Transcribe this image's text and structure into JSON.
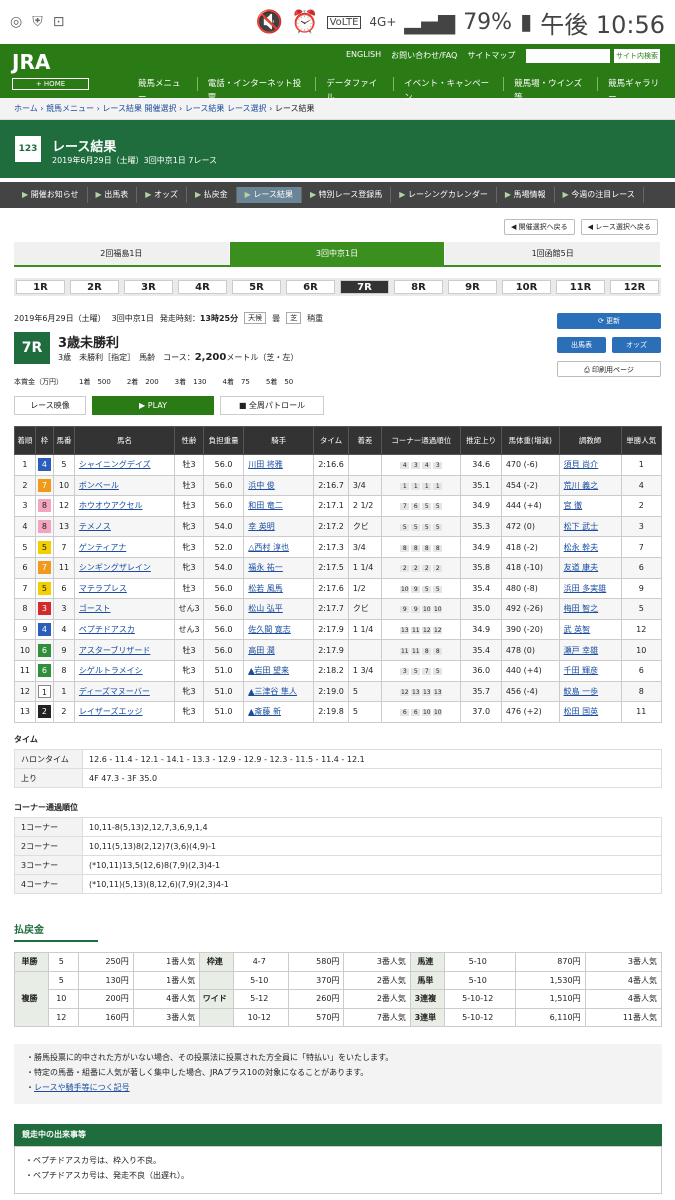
{
  "status": {
    "battery": "79%",
    "time": "午後 10:56",
    "net": "4G+",
    "volte": "VoLTE"
  },
  "header": {
    "logo": "JRA",
    "home": "+ HOME",
    "top_links": [
      "ENGLISH",
      "お問い合わせ/FAQ",
      "サイトマップ"
    ],
    "search_btn": "サイト内検索",
    "menu": [
      "競馬メニュー",
      "電話・インターネット投票",
      "データファイル",
      "イベント・キャンペーン",
      "競馬場・ウインズ等",
      "競馬ギャラリー"
    ]
  },
  "breadcrumb": [
    "ホーム",
    "競馬メニュー",
    "レース結果 開催選択",
    "レース結果 レース選択",
    "レース結果"
  ],
  "title": {
    "heading": "レース結果",
    "sub": "2019年6月29日（土曜）3回中京1日 7レース"
  },
  "nav": [
    "開催お知らせ",
    "出馬表",
    "オッズ",
    "払戻金",
    "レース結果",
    "特別レース登録馬",
    "レーシングカレンダー",
    "馬場情報",
    "今週の注目レース"
  ],
  "back_buttons": [
    "開催選択へ戻る",
    "レース選択へ戻る"
  ],
  "venues": [
    "2回福島1日",
    "3回中京1日",
    "1回函館5日"
  ],
  "races": [
    "1R",
    "2R",
    "3R",
    "4R",
    "5R",
    "6R",
    "7R",
    "8R",
    "9R",
    "10R",
    "11R",
    "12R"
  ],
  "race": {
    "date": "2019年6月29日（土曜）",
    "meet": "3回中京1日",
    "post_label": "発走時刻：",
    "post": "13時25分",
    "weather": "天候",
    "weather_val": "曇",
    "track": "芝",
    "cond": "稍重",
    "num": "7R",
    "name": "3歳未勝利",
    "meta": "3歳　未勝利［指定］　馬齢",
    "course": "コース：",
    "dist": "2,200",
    "unit": "メートル（芝・左）"
  },
  "prize": {
    "label": "本賞金（万円）",
    "items": [
      "1着　500",
      "2着　200",
      "3着　130",
      "4着　75",
      "5着　50"
    ]
  },
  "side_buttons": [
    "更新",
    "出馬表",
    "オッズ",
    "印刷用ページ"
  ],
  "video": [
    "レース映像",
    "PLAY",
    "全周パトロール"
  ],
  "columns": [
    "着順",
    "枠",
    "馬番",
    "馬名",
    "性齢",
    "負担重量",
    "騎手",
    "タイム",
    "着差",
    "コーナー通過順位",
    "推定上り",
    "馬体重(増減)",
    "調教師",
    "単勝人気"
  ],
  "results": [
    {
      "rank": "1",
      "waku": "4",
      "num": "5",
      "name": "シャイニングデイズ",
      "sex": "牡3",
      "wt": "56.0",
      "jockey": "川田 将雅",
      "time": "2:16.6",
      "margin": "",
      "pass": [
        "4",
        "3",
        "4",
        "3"
      ],
      "agari": "34.6",
      "body": "470 (-6)",
      "trainer": "須貝 尚介",
      "pop": "1"
    },
    {
      "rank": "2",
      "waku": "7",
      "num": "10",
      "name": "ボンベール",
      "sex": "牡3",
      "wt": "56.0",
      "jockey": "浜中 俊",
      "time": "2:16.7",
      "margin": "3/4",
      "pass": [
        "1",
        "1",
        "1",
        "1"
      ],
      "agari": "35.1",
      "body": "454 (-2)",
      "trainer": "荒川 義之",
      "pop": "4"
    },
    {
      "rank": "3",
      "waku": "8",
      "num": "12",
      "name": "ホウオウアクセル",
      "sex": "牡3",
      "wt": "56.0",
      "jockey": "和田 竜二",
      "time": "2:17.1",
      "margin": "2 1/2",
      "pass": [
        "7",
        "6",
        "5",
        "5"
      ],
      "agari": "34.9",
      "body": "444 (+4)",
      "trainer": "宮 徹",
      "pop": "2"
    },
    {
      "rank": "4",
      "waku": "8",
      "num": "13",
      "name": "テメノス",
      "sex": "牝3",
      "wt": "54.0",
      "jockey": "幸 英明",
      "time": "2:17.2",
      "margin": "クビ",
      "pass": [
        "5",
        "5",
        "5",
        "5"
      ],
      "agari": "35.3",
      "body": "472 (0)",
      "trainer": "松下 武士",
      "pop": "3"
    },
    {
      "rank": "5",
      "waku": "5",
      "num": "7",
      "name": "ゲンティアナ",
      "sex": "牝3",
      "wt": "52.0",
      "jockey": "△西村 淳也",
      "time": "2:17.3",
      "margin": "3/4",
      "pass": [
        "8",
        "8",
        "8",
        "8"
      ],
      "agari": "34.9",
      "body": "418 (-2)",
      "trainer": "松永 幹夫",
      "pop": "7"
    },
    {
      "rank": "6",
      "waku": "7",
      "num": "11",
      "name": "シンギングザレイン",
      "sex": "牝3",
      "wt": "54.0",
      "jockey": "福永 祐一",
      "time": "2:17.5",
      "margin": "1 1/4",
      "pass": [
        "2",
        "2",
        "2",
        "2"
      ],
      "agari": "35.8",
      "body": "418 (-10)",
      "trainer": "友道 康夫",
      "pop": "6"
    },
    {
      "rank": "7",
      "waku": "5",
      "num": "6",
      "name": "マテラプレス",
      "sex": "牡3",
      "wt": "56.0",
      "jockey": "松若 風馬",
      "time": "2:17.6",
      "margin": "1/2",
      "pass": [
        "10",
        "9",
        "5",
        "5"
      ],
      "agari": "35.4",
      "body": "480 (-8)",
      "trainer": "浜田 多実雄",
      "pop": "9"
    },
    {
      "rank": "8",
      "waku": "3",
      "num": "3",
      "name": "ゴースト",
      "sex": "せん3",
      "wt": "56.0",
      "jockey": "松山 弘平",
      "time": "2:17.7",
      "margin": "クビ",
      "pass": [
        "9",
        "9",
        "10",
        "10"
      ],
      "agari": "35.0",
      "body": "492 (-26)",
      "trainer": "梅田 智之",
      "pop": "5"
    },
    {
      "rank": "9",
      "waku": "4",
      "num": "4",
      "name": "ペプチドアスカ",
      "sex": "せん3",
      "wt": "56.0",
      "jockey": "佐久間 寛志",
      "time": "2:17.9",
      "margin": "1 1/4",
      "pass": [
        "13",
        "11",
        "12",
        "12"
      ],
      "agari": "34.9",
      "body": "390 (-20)",
      "trainer": "武 英智",
      "pop": "12"
    },
    {
      "rank": "10",
      "waku": "6",
      "num": "9",
      "name": "アスターブリザード",
      "sex": "牡3",
      "wt": "56.0",
      "jockey": "高田 潤",
      "time": "2:17.9",
      "margin": "",
      "pass": [
        "11",
        "11",
        "8",
        "8"
      ],
      "agari": "35.4",
      "body": "478 (0)",
      "trainer": "瀬戸 幸雄",
      "pop": "10"
    },
    {
      "rank": "11",
      "waku": "6",
      "num": "8",
      "name": "シゲルトラメイシ",
      "sex": "牝3",
      "wt": "51.0",
      "jockey": "▲岩田 望来",
      "time": "2:18.2",
      "margin": "1 3/4",
      "pass": [
        "3",
        "5",
        "7",
        "5"
      ],
      "agari": "36.0",
      "body": "440 (+4)",
      "trainer": "千田 輝彦",
      "pop": "6"
    },
    {
      "rank": "12",
      "waku": "1",
      "num": "1",
      "name": "ディーズマヌーバー",
      "sex": "牝3",
      "wt": "51.0",
      "jockey": "▲三津谷 隼人",
      "time": "2:19.0",
      "margin": "5",
      "pass": [
        "12",
        "13",
        "13",
        "13"
      ],
      "agari": "35.7",
      "body": "456 (-4)",
      "trainer": "鮫島 一歩",
      "pop": "8"
    },
    {
      "rank": "13",
      "waku": "2",
      "num": "2",
      "name": "レイザーズエッジ",
      "sex": "牝3",
      "wt": "51.0",
      "jockey": "▲斎藤 新",
      "time": "2:19.8",
      "margin": "5",
      "pass": [
        "6",
        "6",
        "10",
        "10"
      ],
      "agari": "37.0",
      "body": "476 (+2)",
      "trainer": "松田 国英",
      "pop": "11"
    }
  ],
  "waku_colors": {
    "1": "#ffffff",
    "2": "#222222",
    "3": "#d12b2b",
    "4": "#2b5ebb",
    "5": "#f2d000",
    "6": "#2f8f3a",
    "7": "#f09a1b",
    "8": "#f2a4c0"
  },
  "time_sec": {
    "title": "タイム",
    "rows": [
      {
        "k": "ハロンタイム",
        "v": "12.6 - 11.4 - 12.1 - 14.1 - 13.3 - 12.9 - 12.9 - 12.3 - 11.5 - 11.4 - 12.1"
      },
      {
        "k": "上り",
        "v": "4F 47.3 - 3F 35.0"
      }
    ]
  },
  "corner_sec": {
    "title": "コーナー通過順位",
    "rows": [
      {
        "k": "1コーナー",
        "v": "10,11-8(5,13)2,12,7,3,6,9,1,4"
      },
      {
        "k": "2コーナー",
        "v": "10,11(5,13)8(2,12)7(3,6)(4,9)-1"
      },
      {
        "k": "3コーナー",
        "v": "(*10,11)13,5(12,6)8(7,9)(2,3)4-1"
      },
      {
        "k": "4コーナー",
        "v": "(*10,11)(5,13)(8,12,6)(7,9)(2,3)4-1"
      }
    ]
  },
  "payout": {
    "title": "払戻金",
    "rows": [
      [
        "単勝",
        "5",
        "250円",
        "1番人気",
        "枠連",
        "4-7",
        "580円",
        "3番人気",
        "馬連",
        "5-10",
        "870円",
        "3番人気"
      ],
      [
        "複勝",
        "5",
        "130円",
        "1番人気",
        "",
        "5-10",
        "370円",
        "2番人気",
        "馬単",
        "5-10",
        "1,530円",
        "4番人気"
      ],
      [
        "",
        "10",
        "200円",
        "4番人気",
        "ワイド",
        "5-12",
        "260円",
        "2番人気",
        "3連複",
        "5-10-12",
        "1,510円",
        "4番人気"
      ],
      [
        "",
        "12",
        "160円",
        "3番人気",
        "",
        "10-12",
        "570円",
        "7番人気",
        "3連単",
        "5-10-12",
        "6,110円",
        "11番人気"
      ]
    ]
  },
  "notes": [
    "勝馬投票に的中された方がいない場合、その投票法に投票された方全員に「特払い」をいたします。",
    "特定の馬番・組番に人気が著しく集中した場合、JRAプラス10の対象になることがあります。",
    "レースや騎手等につく記号"
  ],
  "events": {
    "title": "競走中の出来事等",
    "items": [
      "ペプチドアスカ号は、枠入り不良。",
      "ペプチドアスカ号は、発走不良（出遅れ）。"
    ]
  }
}
